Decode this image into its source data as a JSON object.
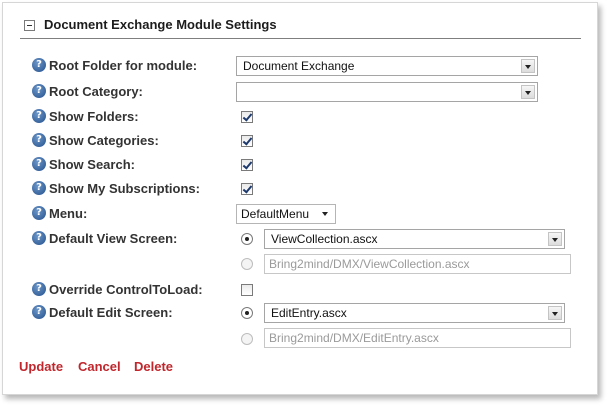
{
  "header": {
    "title": "Document Exchange Module Settings"
  },
  "fields": {
    "root_folder": {
      "label": "Root Folder for module:",
      "value": "Document Exchange"
    },
    "root_category": {
      "label": "Root Category:",
      "value": ""
    },
    "show_folders": {
      "label": "Show Folders:",
      "checked": true
    },
    "show_categories": {
      "label": "Show Categories:",
      "checked": true
    },
    "show_search": {
      "label": "Show Search:",
      "checked": true
    },
    "show_subscriptions": {
      "label": "Show My Subscriptions:",
      "checked": true
    },
    "menu": {
      "label": "Menu:",
      "value": "DefaultMenu"
    },
    "default_view": {
      "label": "Default View Screen:",
      "selected": "ViewCollection.ascx",
      "custom_path": "Bring2mind/DMX/ViewCollection.ascx"
    },
    "override_control": {
      "label": "Override ControlToLoad:",
      "checked": false
    },
    "default_edit": {
      "label": "Default Edit Screen:",
      "selected": "EditEntry.ascx",
      "custom_path": "Bring2mind/DMX/EditEntry.ascx"
    }
  },
  "help_icon_glyph": "?",
  "actions": {
    "update": "Update",
    "cancel": "Cancel",
    "delete": "Delete"
  },
  "colors": {
    "link": "#c0262c",
    "help_icon": "#2d5a95"
  }
}
